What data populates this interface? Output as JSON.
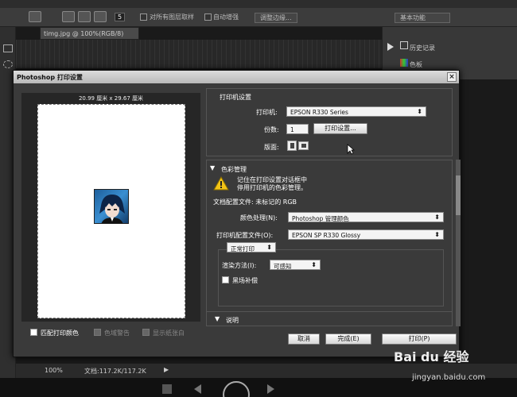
{
  "photoshop": {
    "options": {
      "size_value": "5",
      "all_layers_label": "对所有图层取样",
      "auto_enhance_label": "自动增强",
      "refine_edge_label": "调整边缘...",
      "workspace": "基本功能"
    },
    "doc_tab": "timg.jpg @ 100%(RGB/8)",
    "panels": {
      "history": "历史记录",
      "color": "色板"
    },
    "status": {
      "zoom": "100%",
      "doc": "文档:117.2K/117.2K"
    }
  },
  "dialog": {
    "title": "Photoshop 打印设置",
    "close": "×",
    "paper_size": "20.99 厘米 x 29.67 厘米",
    "match_print_colors": "匹配打印颜色",
    "gamut_warning": "色域警告",
    "show_paper_white": "显示纸张白",
    "printer_setup": {
      "section_title": "打印机设置",
      "printer_label": "打印机:",
      "printer_value": "EPSON R330 Series",
      "copies_label": "份数:",
      "copies_value": "1",
      "print_settings_button": "打印设置...",
      "layout_label": "版面:"
    },
    "color_management": {
      "section_title": "色彩管理",
      "warning_line1": "记住在打印设置对话框中",
      "warning_line2": "停用打印机的色彩管理。",
      "doc_profile": "文档配置文件: 未标记的 RGB",
      "color_handling_label": "颜色处理(N):",
      "color_handling_value": "Photoshop 管理颜色",
      "printer_profile_label": "打印机配置文件(O):",
      "printer_profile_value": "EPSON SP R330 Glossy",
      "normal_printing": "正常打印",
      "rendering_intent_label": "渲染方法(I):",
      "rendering_intent_value": "可感知",
      "black_point_label": "黑场补偿"
    },
    "description_label": "说明",
    "buttons": {
      "cancel": "取消",
      "done": "完成(E)",
      "print": "打印(P)"
    }
  },
  "watermark": {
    "brand": "Bai du 经验",
    "url": "jingyan.baidu.com"
  }
}
